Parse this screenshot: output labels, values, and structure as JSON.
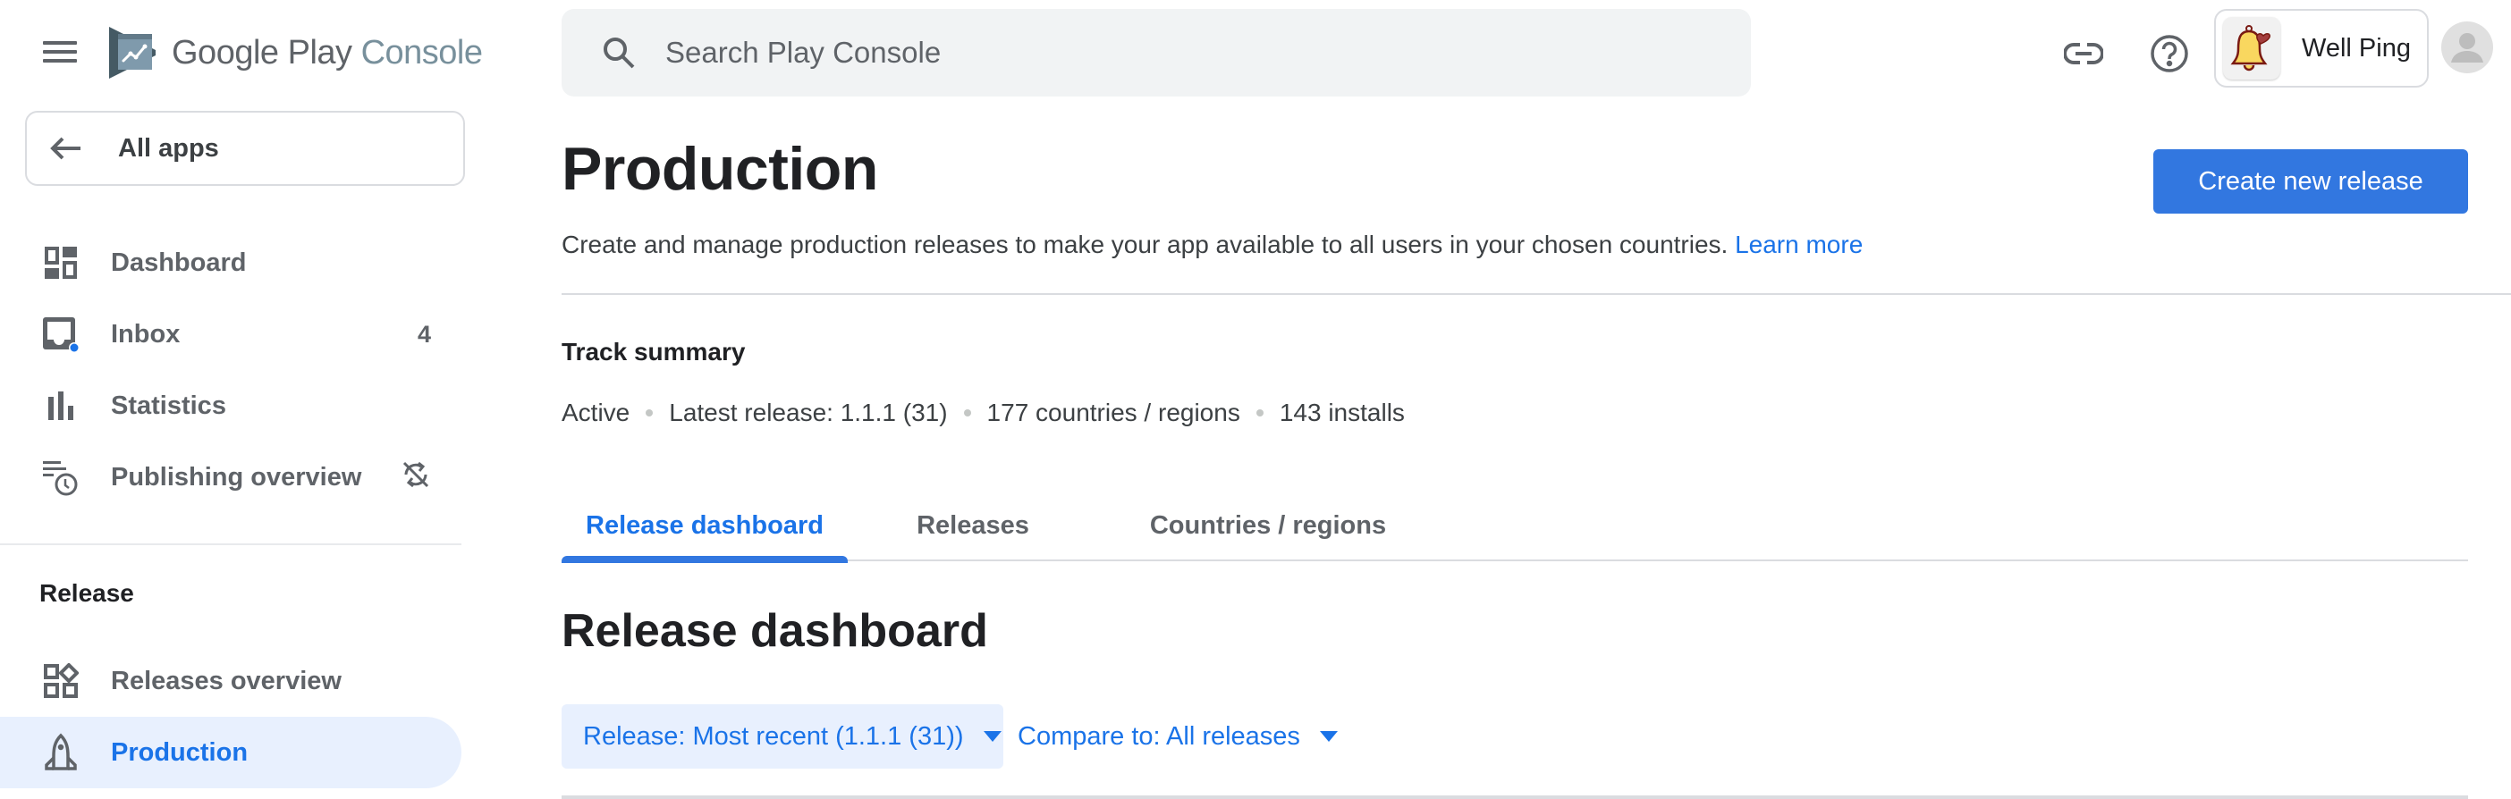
{
  "brand": {
    "logo_word1": "Google Play",
    "logo_word2": "Console"
  },
  "sidebar": {
    "back_label": "All apps",
    "items": [
      {
        "label": "Dashboard",
        "icon": "dashboard-icon"
      },
      {
        "label": "Inbox",
        "icon": "inbox-icon",
        "badge": "4"
      },
      {
        "label": "Statistics",
        "icon": "bar-chart-icon"
      },
      {
        "label": "Publishing overview",
        "icon": "publishing-schedule-icon",
        "trailing_icon": "sync-disabled-icon"
      }
    ],
    "section_label": "Release",
    "release_items": [
      {
        "label": "Releases overview",
        "icon": "releases-overview-icon"
      },
      {
        "label": "Production",
        "icon": "rocket-icon",
        "active": true
      }
    ]
  },
  "header": {
    "search_placeholder": "Search Play Console",
    "search_value": "",
    "app_name": "Well Ping"
  },
  "main": {
    "title": "Production",
    "create_button": "Create new release",
    "description": "Create and manage production releases to make your app available to all users in your chosen countries.",
    "learn_more": "Learn more",
    "track_summary": {
      "title": "Track summary",
      "items": [
        "Active",
        "Latest release: 1.1.1 (31)",
        "177 countries / regions",
        "143 installs"
      ]
    },
    "tabs": [
      {
        "label": "Release dashboard",
        "active": true
      },
      {
        "label": "Releases",
        "active": false
      },
      {
        "label": "Countries / regions",
        "active": false
      }
    ],
    "section_title": "Release dashboard",
    "filters": {
      "release": "Release: Most recent (1.1.1 (31))",
      "compare": "Compare to: All releases"
    }
  },
  "colors": {
    "accent": "#1a73e8",
    "primary_button": "#3277e0",
    "active_nav_bg": "#e8f0fe",
    "notification_dot": "#1a73e8"
  }
}
